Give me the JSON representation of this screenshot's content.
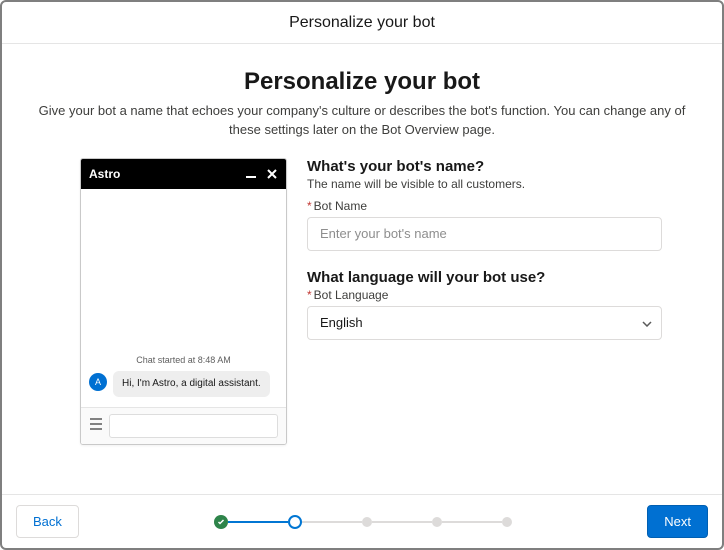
{
  "modal_title": "Personalize your bot",
  "page": {
    "title": "Personalize your bot",
    "subtitle": "Give your bot a name that echoes your company's culture or describes the bot's function. You can change any of these settings later on the Bot Overview page."
  },
  "chat_preview": {
    "bot_name": "Astro",
    "avatar_letter": "A",
    "chat_started": "Chat started at 8:48 AM",
    "welcome_message": "Hi, I'm Astro, a digital assistant."
  },
  "form": {
    "name_section": {
      "heading": "What's your bot's name?",
      "sub": "The name will be visible to all customers.",
      "label": "Bot Name",
      "placeholder": "Enter your bot's name",
      "value": ""
    },
    "lang_section": {
      "heading": "What language will your bot use?",
      "label": "Bot Language",
      "selected": "English"
    }
  },
  "footer": {
    "back": "Back",
    "next": "Next"
  }
}
